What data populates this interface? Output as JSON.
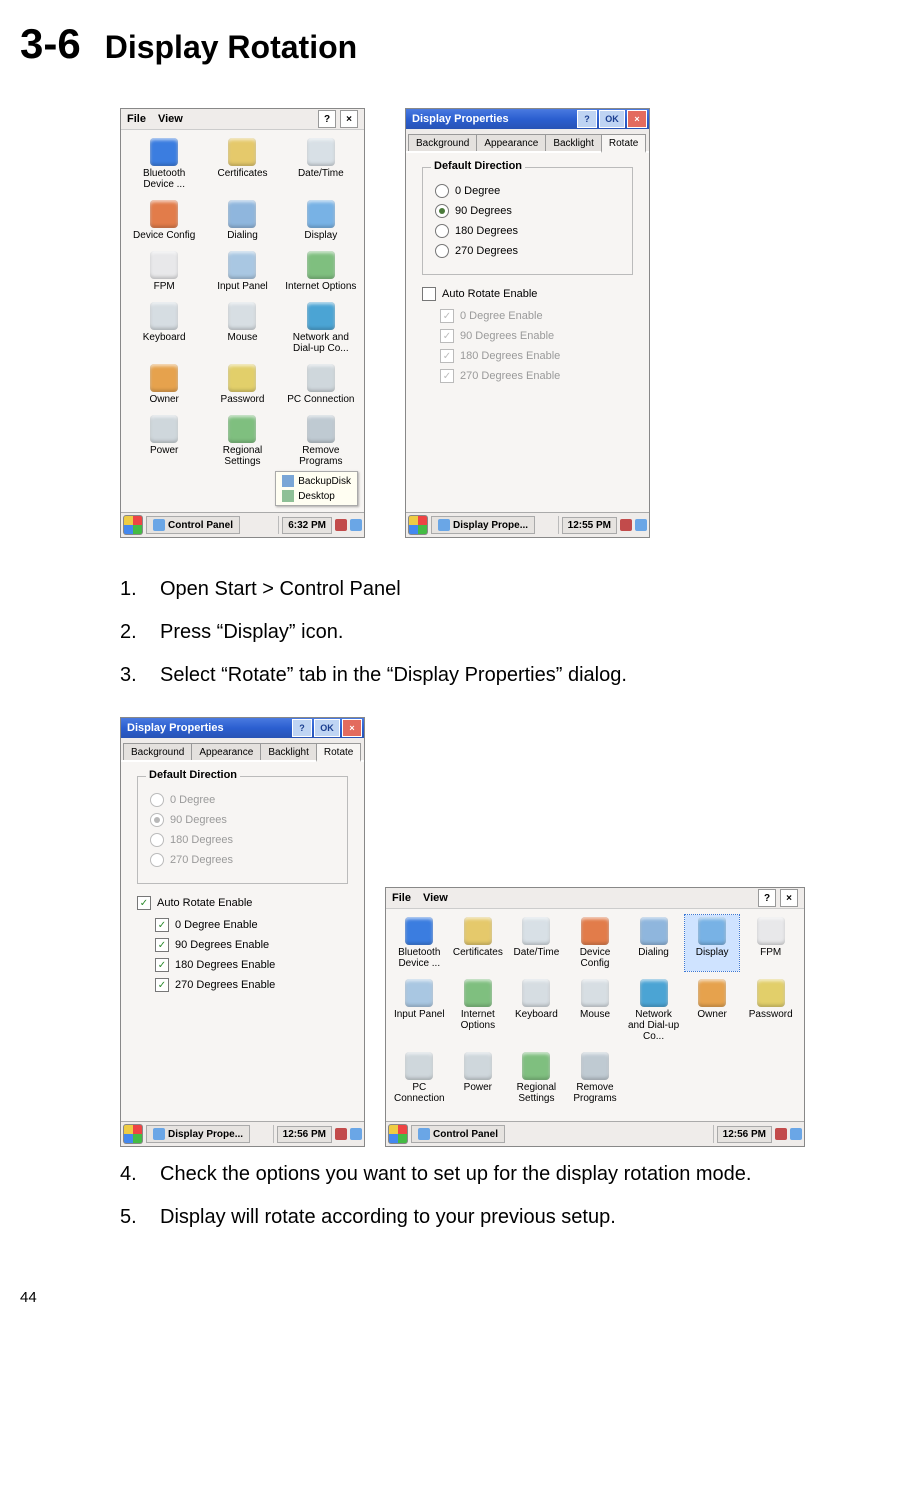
{
  "heading": {
    "num": "3-6",
    "title": "Display Rotation"
  },
  "steps": [
    {
      "n": "1.",
      "t": "Open Start > Control Panel"
    },
    {
      "n": "2.",
      "t": "Press “Display” icon."
    },
    {
      "n": "3.",
      "t": "Select “Rotate” tab in the “Display Properties” dialog."
    },
    {
      "n": "4.",
      "t": "Check the options you want to set up for the display rotation mode."
    },
    {
      "n": "5.",
      "t": "Display will rotate according to your previous setup."
    }
  ],
  "page_num": "44",
  "cp": {
    "menu_file": "File",
    "menu_view": "View",
    "help": "?",
    "close": "×",
    "popup": {
      "backup": "BackupDisk",
      "desktop": "Desktop"
    },
    "items_v": [
      {
        "l": "Bluetooth Device ...",
        "c": "#3b7de0"
      },
      {
        "l": "Certificates",
        "c": "#e5c96b"
      },
      {
        "l": "Date/Time",
        "c": "#d8e0e6"
      },
      {
        "l": "Device Config",
        "c": "#e27c4a"
      },
      {
        "l": "Dialing",
        "c": "#8fb6dd"
      },
      {
        "l": "Display",
        "c": "#78b2e5"
      },
      {
        "l": "FPM",
        "c": "#e8e8ea"
      },
      {
        "l": "Input Panel",
        "c": "#a9c7e2"
      },
      {
        "l": "Internet Options",
        "c": "#7fbf7f"
      },
      {
        "l": "Keyboard",
        "c": "#d6dde2"
      },
      {
        "l": "Mouse",
        "c": "#d7dee3"
      },
      {
        "l": "Network and Dial-up Co...",
        "c": "#4ba4d4"
      },
      {
        "l": "Owner",
        "c": "#e6a24d"
      },
      {
        "l": "Password",
        "c": "#e2cf6a"
      },
      {
        "l": "PC Connection",
        "c": "#cfd7dc"
      },
      {
        "l": "Power",
        "c": "#cfd7dc"
      },
      {
        "l": "Regional Settings",
        "c": "#7fbf7f"
      },
      {
        "l": "Remove Programs",
        "c": "#bfcad2"
      }
    ],
    "items_h": [
      {
        "l": "Bluetooth Device ...",
        "c": "#3b7de0"
      },
      {
        "l": "Certificates",
        "c": "#e5c96b"
      },
      {
        "l": "Date/Time",
        "c": "#d8e0e6"
      },
      {
        "l": "Device Config",
        "c": "#e27c4a"
      },
      {
        "l": "Dialing",
        "c": "#8fb6dd"
      },
      {
        "l": "Display",
        "c": "#78b2e5",
        "sel": true
      },
      {
        "l": "FPM",
        "c": "#e8e8ea"
      },
      {
        "l": "Input Panel",
        "c": "#a9c7e2"
      },
      {
        "l": "Internet Options",
        "c": "#7fbf7f"
      },
      {
        "l": "Keyboard",
        "c": "#d6dde2"
      },
      {
        "l": "Mouse",
        "c": "#d7dee3"
      },
      {
        "l": "Network and Dial-up Co...",
        "c": "#4ba4d4"
      },
      {
        "l": "Owner",
        "c": "#e6a24d"
      },
      {
        "l": "Password",
        "c": "#e2cf6a"
      },
      {
        "l": "PC Connection",
        "c": "#cfd7dc"
      },
      {
        "l": "Power",
        "c": "#cfd7dc"
      },
      {
        "l": "Regional Settings",
        "c": "#7fbf7f"
      },
      {
        "l": "Remove Programs",
        "c": "#bfcad2"
      }
    ],
    "task_v": {
      "label": "Control Panel",
      "time": "6:32 PM"
    },
    "task_h": {
      "label": "Control Panel",
      "time": "12:56 PM"
    }
  },
  "dp": {
    "title": "Display Properties",
    "tabs": [
      "Background",
      "Appearance",
      "Backlight",
      "Rotate"
    ],
    "active_tab": "Rotate",
    "group_title": "Default Direction",
    "radios": [
      "0 Degree",
      "90 Degrees",
      "180 Degrees",
      "270 Degrees"
    ],
    "auto_label": "Auto Rotate Enable",
    "auto_items": [
      "0 Degree Enable",
      "90 Degrees Enable",
      "180 Degrees Enable",
      "270 Degrees Enable"
    ],
    "task_label": "Display Prope...",
    "ok": "OK",
    "help": "?",
    "close": "×",
    "time1": "12:55 PM",
    "time2": "12:56 PM",
    "state1": {
      "selected_radio": 1,
      "auto_on": false,
      "checks": [
        true,
        true,
        true,
        true
      ],
      "dimmed": true
    },
    "state2": {
      "selected_radio": 1,
      "selected_grey": true,
      "auto_on": true,
      "checks": [
        true,
        true,
        true,
        true
      ],
      "dimmed": false
    }
  }
}
